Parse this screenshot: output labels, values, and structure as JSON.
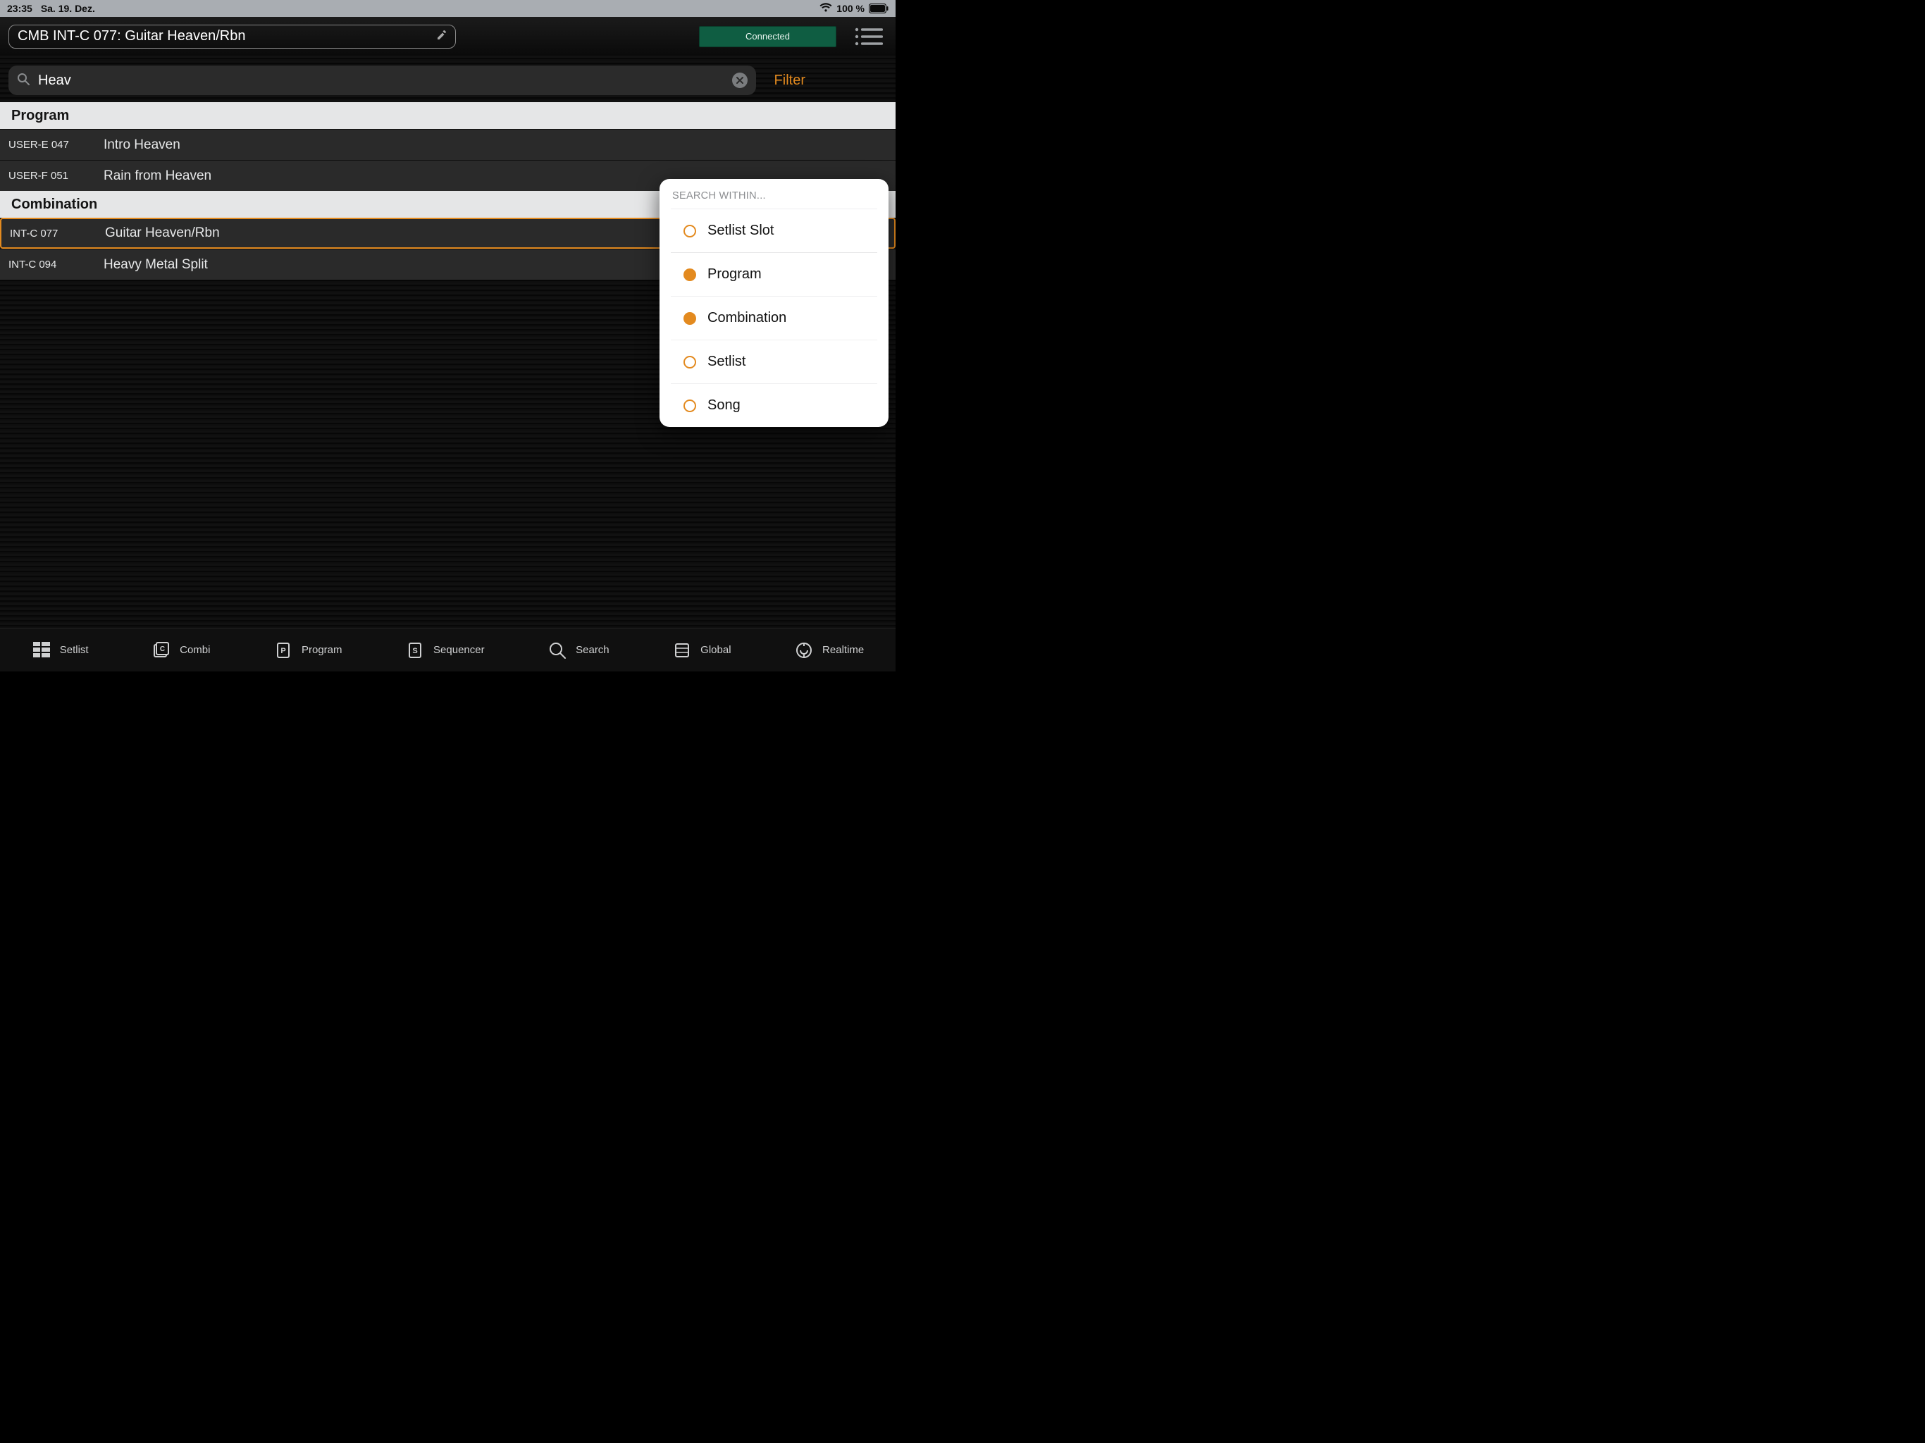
{
  "status": {
    "time": "23:35",
    "date": "Sa. 19. Dez.",
    "battery": "100 %"
  },
  "header": {
    "title": "CMB INT-C 077: Guitar Heaven/Rbn",
    "connection": "Connected"
  },
  "search": {
    "value": "Heav",
    "filter_label": "Filter"
  },
  "sections": [
    {
      "title": "Program",
      "rows": [
        {
          "code": "USER-E 047",
          "name": "Intro Heaven",
          "selected": false
        },
        {
          "code": "USER-F 051",
          "name": "Rain from Heaven",
          "selected": false
        }
      ]
    },
    {
      "title": "Combination",
      "rows": [
        {
          "code": "INT-C 077",
          "name": "Guitar Heaven/Rbn",
          "selected": true
        },
        {
          "code": "INT-C 094",
          "name": "Heavy Metal Split",
          "selected": false
        }
      ]
    }
  ],
  "popover": {
    "heading": "SEARCH WITHIN...",
    "items": [
      {
        "label": "Setlist Slot",
        "checked": false
      },
      {
        "label": "Program",
        "checked": true
      },
      {
        "label": "Combination",
        "checked": true
      },
      {
        "label": "Setlist",
        "checked": false
      },
      {
        "label": "Song",
        "checked": false
      }
    ]
  },
  "nav": {
    "items": [
      {
        "label": "Setlist"
      },
      {
        "label": "Combi"
      },
      {
        "label": "Program"
      },
      {
        "label": "Sequencer"
      },
      {
        "label": "Search"
      },
      {
        "label": "Global"
      },
      {
        "label": "Realtime"
      }
    ]
  }
}
